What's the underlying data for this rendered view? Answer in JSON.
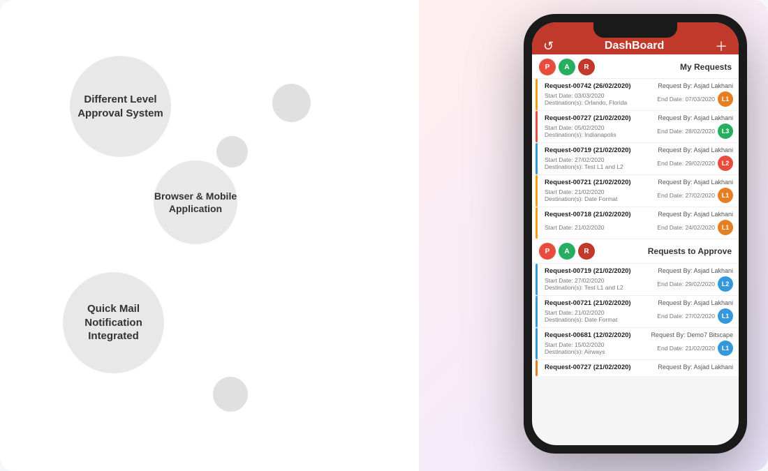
{
  "page": {
    "background": "white"
  },
  "features": [
    {
      "id": "approval",
      "label": "Different Level Approval System",
      "size": "large"
    },
    {
      "id": "browser",
      "label": "Browser & Mobile Application",
      "size": "medium"
    },
    {
      "id": "mail",
      "label": "Quick Mail Notification Integrated",
      "size": "large"
    }
  ],
  "app": {
    "title": "DashBoard",
    "avatars": [
      {
        "letter": "P",
        "color": "#e74c3c"
      },
      {
        "letter": "A",
        "color": "#27ae60"
      },
      {
        "letter": "R",
        "color": "#c0392b"
      }
    ],
    "my_requests_label": "My Requests",
    "requests_to_approve_label": "Requests to Approve",
    "requests": [
      {
        "id": "Request-00742 (26/02/2020)",
        "by": "Request By: Asjad Lakhani",
        "start": "Start Date: 03/03/2020",
        "end": "End Date: 07/03/2020",
        "destination": "Destination(s): Orlando, Florida",
        "bar_color": "#f39c12",
        "badge": "L1",
        "badge_color": "#e67e22"
      },
      {
        "id": "Request-00727 (21/02/2020)",
        "by": "Request By: Asjad Lakhani",
        "start": "Start Date: 05/02/2020",
        "end": "End Date: 28/02/2020",
        "destination": "Destination(s): Indianapolis",
        "bar_color": "#e74c3c",
        "badge": "L3",
        "badge_color": "#27ae60"
      },
      {
        "id": "Request-00719 (21/02/2020)",
        "by": "Request By: Asjad Lakhani",
        "start": "Start Date: 27/02/2020",
        "end": "End Date: 29/02/2020",
        "destination": "Destination(s): Test L1 and L2",
        "bar_color": "#3498db",
        "badge": "L2",
        "badge_color": "#e74c3c"
      },
      {
        "id": "Request-00721 (21/02/2020)",
        "by": "Request By: Asjad Lakhani",
        "start": "Start Date: 21/02/2020",
        "end": "End Date: 27/02/2020",
        "destination": "Destination(s): Date Format",
        "bar_color": "#f39c12",
        "badge": "L1",
        "badge_color": "#e67e22"
      },
      {
        "id": "Request-00718 (21/02/2020)",
        "by": "Request By: Asjad Lakhani",
        "start": "Start Date: 21/02/2020",
        "end": "End Date: 24/02/2020",
        "destination": "",
        "bar_color": "#f39c12",
        "badge": "L1",
        "badge_color": "#e67e22"
      }
    ],
    "approve_requests": [
      {
        "id": "Request-00719 (21/02/2020)",
        "by": "Request By: Asjad Lakhani",
        "start": "Start Date: 27/02/2020",
        "end": "End Date: 29/02/2020",
        "destination": "Destination(s): Test L1 and L2",
        "bar_color": "#3498db",
        "badge": "L2",
        "badge_color": "#3498db"
      },
      {
        "id": "Request-00721 (21/02/2020)",
        "by": "Request By: Asjad Lakhani",
        "start": "Start Date: 21/02/2020",
        "end": "End Date: 27/02/2020",
        "destination": "Destination(s): Date Format",
        "bar_color": "#3498db",
        "badge": "L1",
        "badge_color": "#3498db"
      },
      {
        "id": "Request-00681 (12/02/2020)",
        "by": "Request By: Demo7 Bitscape",
        "start": "Start Date: 15/02/2020",
        "end": "End Date: 21/02/2020",
        "destination": "Destination(s): Airways",
        "bar_color": "#3498db",
        "badge": "L1",
        "badge_color": "#3498db"
      },
      {
        "id": "Request-00727 (21/02/2020)",
        "by": "Request By: Asjad Lakhani",
        "start": "",
        "end": "",
        "destination": "",
        "bar_color": "#e67e22",
        "badge": "",
        "badge_color": "#e67e22"
      }
    ]
  }
}
